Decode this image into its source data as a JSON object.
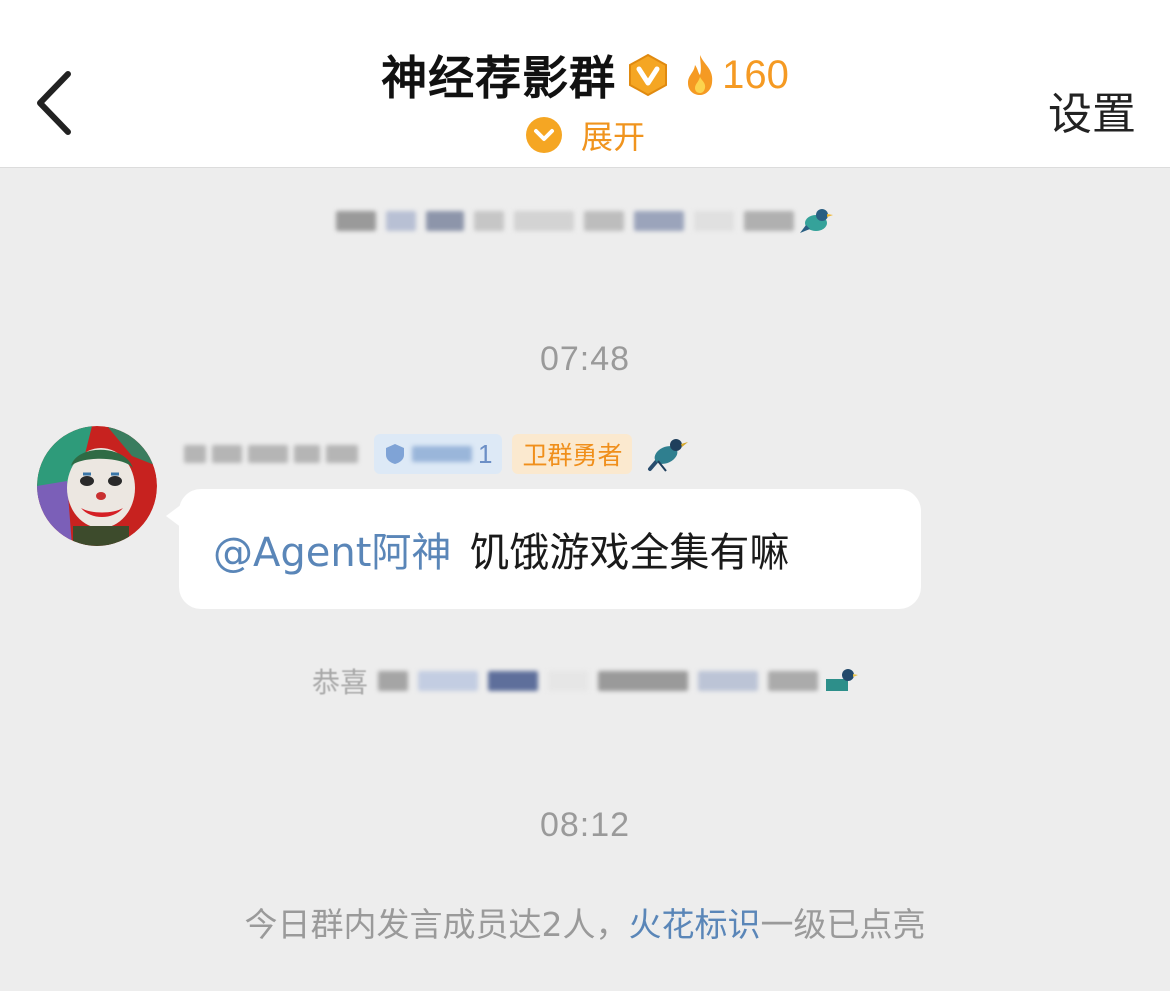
{
  "header": {
    "title": "神经荐影群",
    "fire_count": "160",
    "expand_label": "展开",
    "settings_label": "设置",
    "accent_color": "#f59a23"
  },
  "chat": {
    "timestamp_1": "07:48",
    "message": {
      "level_number": "1",
      "honor_badge": "卫群勇者",
      "mention": "@Agent阿神",
      "text": "饥饿游戏全集有嘛"
    },
    "system_prefix_2": "恭喜",
    "timestamp_2": "08:12",
    "notice": {
      "before": "今日群内发言成员达2人，",
      "link": "火花标识",
      "after": "一级已点亮"
    }
  },
  "icons": {
    "back": "chevron-left-icon",
    "vip": "group-vip-badge-icon",
    "fire": "fire-icon",
    "expand": "chevron-down-circle-icon",
    "bird": "magpie-bird-icon",
    "avatar": "joker-avatar"
  },
  "colors": {
    "link": "#5a86b8",
    "honor": "#f08f1b",
    "background": "#ededed"
  }
}
